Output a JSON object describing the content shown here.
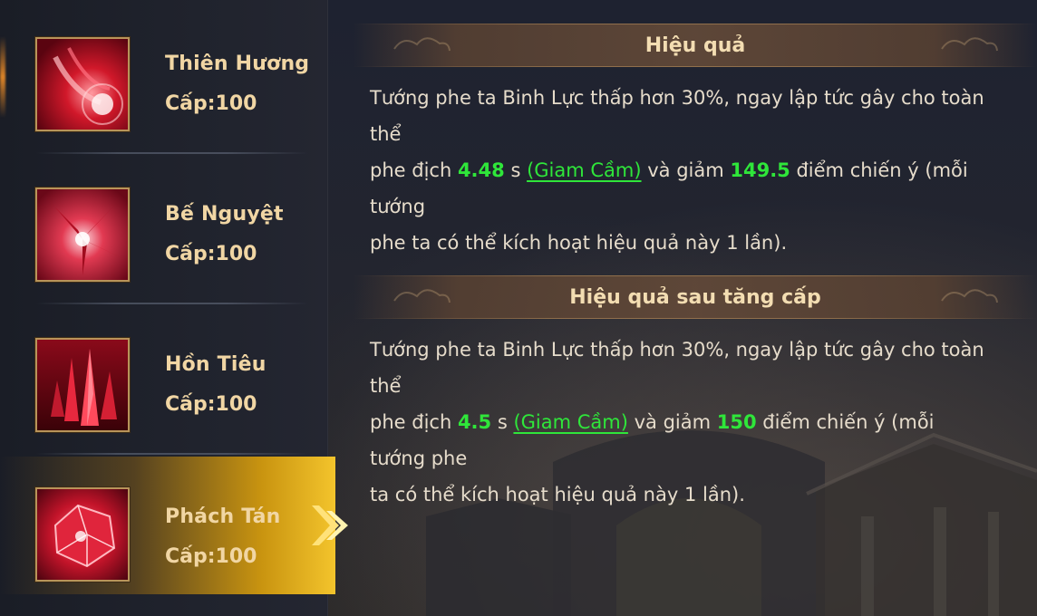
{
  "skills": [
    {
      "name": "Thiên Hương",
      "level": "Cấp:100",
      "icon": "petal-burst-icon"
    },
    {
      "name": "Bế Nguyệt",
      "level": "Cấp:100",
      "icon": "crimson-flower-icon"
    },
    {
      "name": "Hồn Tiêu",
      "level": "Cấp:100",
      "icon": "crystal-shards-icon"
    },
    {
      "name": "Phách Tán",
      "level": "Cấp:100",
      "icon": "shattered-gem-icon",
      "selected": true
    }
  ],
  "effect": {
    "title": "Hiệu quả",
    "line1": "Tướng phe ta Binh Lực thấp hơn 30%, ngay lập tức gây cho toàn thể",
    "line2_pre": "phe địch ",
    "duration": "4.48",
    "unit": " s ",
    "status": "(Giam Cầm)",
    "line2_mid": " và giảm ",
    "reduce": "149.5",
    "line2_post": " điểm chiến ý (mỗi tướng",
    "line3": "phe ta có thể kích hoạt hiệu quả này 1 lần)."
  },
  "upgrade": {
    "title": "Hiệu quả sau tăng cấp",
    "line1": "Tướng phe ta Binh Lực thấp hơn 30%, ngay lập tức gây cho toàn thể",
    "line2_pre": "phe địch ",
    "duration": "4.5",
    "unit": " s ",
    "status": "(Giam Cầm)",
    "line2_mid": " và giảm ",
    "reduce": "150",
    "line2_post": " điểm chiến ý (mỗi tướng phe",
    "line3": "ta có thể kích hoạt hiệu quả này 1 lần)."
  },
  "colors": {
    "highlight_green": "#2fe63a",
    "title_gold": "#f3ddb2",
    "selected_gold": "#f3c42c"
  }
}
